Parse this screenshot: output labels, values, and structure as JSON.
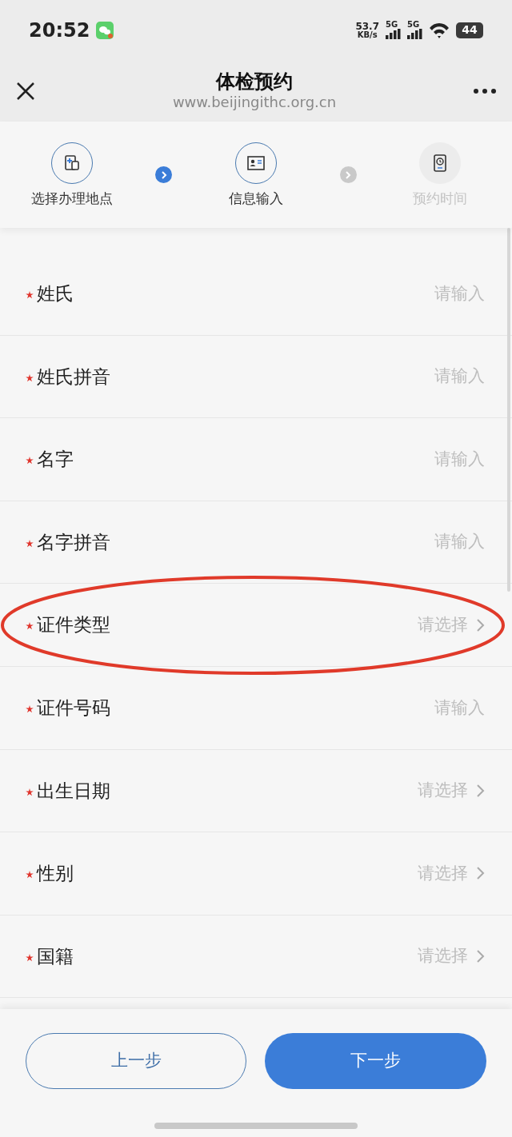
{
  "status_bar": {
    "time": "20:52",
    "speed": "53.7",
    "speed_unit": "KB/s",
    "networks": [
      "5G",
      "5G"
    ],
    "battery": "44"
  },
  "header": {
    "title": "体检预约",
    "url": "www.beijingithc.org.cn"
  },
  "steps": [
    {
      "label": "选择办理地点",
      "active": true
    },
    {
      "label": "信息输入",
      "active": true
    },
    {
      "label": "预约时间",
      "active": false
    }
  ],
  "fields": [
    {
      "label": "姓氏",
      "required": true,
      "kind": "input",
      "placeholder": "请输入",
      "circled": false
    },
    {
      "label": "姓氏拼音",
      "required": true,
      "kind": "input",
      "placeholder": "请输入",
      "circled": false
    },
    {
      "label": "名字",
      "required": true,
      "kind": "input",
      "placeholder": "请输入",
      "circled": false
    },
    {
      "label": "名字拼音",
      "required": true,
      "kind": "input",
      "placeholder": "请输入",
      "circled": false
    },
    {
      "label": "证件类型",
      "required": true,
      "kind": "select",
      "placeholder": "请选择",
      "circled": true
    },
    {
      "label": "证件号码",
      "required": true,
      "kind": "input",
      "placeholder": "请输入",
      "circled": false
    },
    {
      "label": "出生日期",
      "required": true,
      "kind": "select",
      "placeholder": "请选择",
      "circled": false
    },
    {
      "label": "性别",
      "required": true,
      "kind": "select",
      "placeholder": "请选择",
      "circled": false
    },
    {
      "label": "国籍",
      "required": true,
      "kind": "select",
      "placeholder": "请选择",
      "circled": false
    }
  ],
  "buttons": {
    "back": "上一步",
    "next": "下一步"
  }
}
